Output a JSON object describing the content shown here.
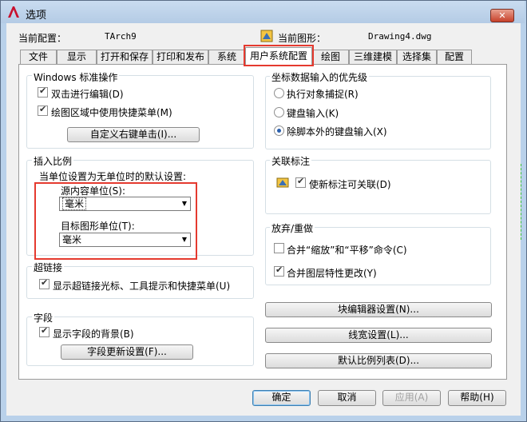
{
  "window": {
    "title": "选项",
    "close_label": "✕"
  },
  "header": {
    "current_config_label": "当前配置：",
    "current_config_value": "TArch9",
    "current_drawing_label": "当前图形：",
    "current_drawing_value": "Drawing4.dwg"
  },
  "tabs": [
    {
      "label": "文件"
    },
    {
      "label": "显示"
    },
    {
      "label": "打开和保存"
    },
    {
      "label": "打印和发布"
    },
    {
      "label": "系统"
    },
    {
      "label": "用户系统配置",
      "active": true
    },
    {
      "label": "绘图"
    },
    {
      "label": "三维建模"
    },
    {
      "label": "选择集"
    },
    {
      "label": "配置"
    }
  ],
  "windows_std": {
    "title": "Windows 标准操作",
    "double_click_edit": "双击进行编辑(D)",
    "shortcut_menu": "绘图区域中使用快捷菜单(M)",
    "custom_right_click": "自定义右键单击(I)..."
  },
  "insert_scale": {
    "title": "插入比例",
    "subtitle": "当单位设置为无单位时的默认设置:",
    "source_label": "源内容单位(S):",
    "source_value": "毫米",
    "target_label": "目标图形单位(T):",
    "target_value": "毫米"
  },
  "hyperlink": {
    "title": "超链接",
    "show_option": "显示超链接光标、工具提示和快捷菜单(U)"
  },
  "fields": {
    "title": "字段",
    "show_background": "显示字段的背景(B)",
    "update_settings": "字段更新设置(F)..."
  },
  "coord_priority": {
    "title": "坐标数据输入的优先级",
    "options": [
      "执行对象捕捉(R)",
      "键盘输入(K)",
      "除脚本外的键盘输入(X)"
    ],
    "selected_index": 2
  },
  "assoc_dim": {
    "title": "关联标注",
    "make_associative": "使新标注可关联(D)"
  },
  "undo_redo": {
    "title": "放弃/重做",
    "combine_zoom_pan": "合并“缩放”和“平移”命令(C)",
    "combine_layer_changes": "合并图层特性更改(Y)"
  },
  "right_buttons": {
    "block_editor": "块编辑器设置(N)...",
    "lineweight": "线宽设置(L)...",
    "scale_list": "默认比例列表(D)..."
  },
  "footer": {
    "ok": "确定",
    "cancel": "取消",
    "apply": "应用(A)",
    "help": "帮助(H)"
  },
  "colors": {
    "highlight_box": "#e53a2f",
    "window_frame": "#b9d1ea"
  }
}
